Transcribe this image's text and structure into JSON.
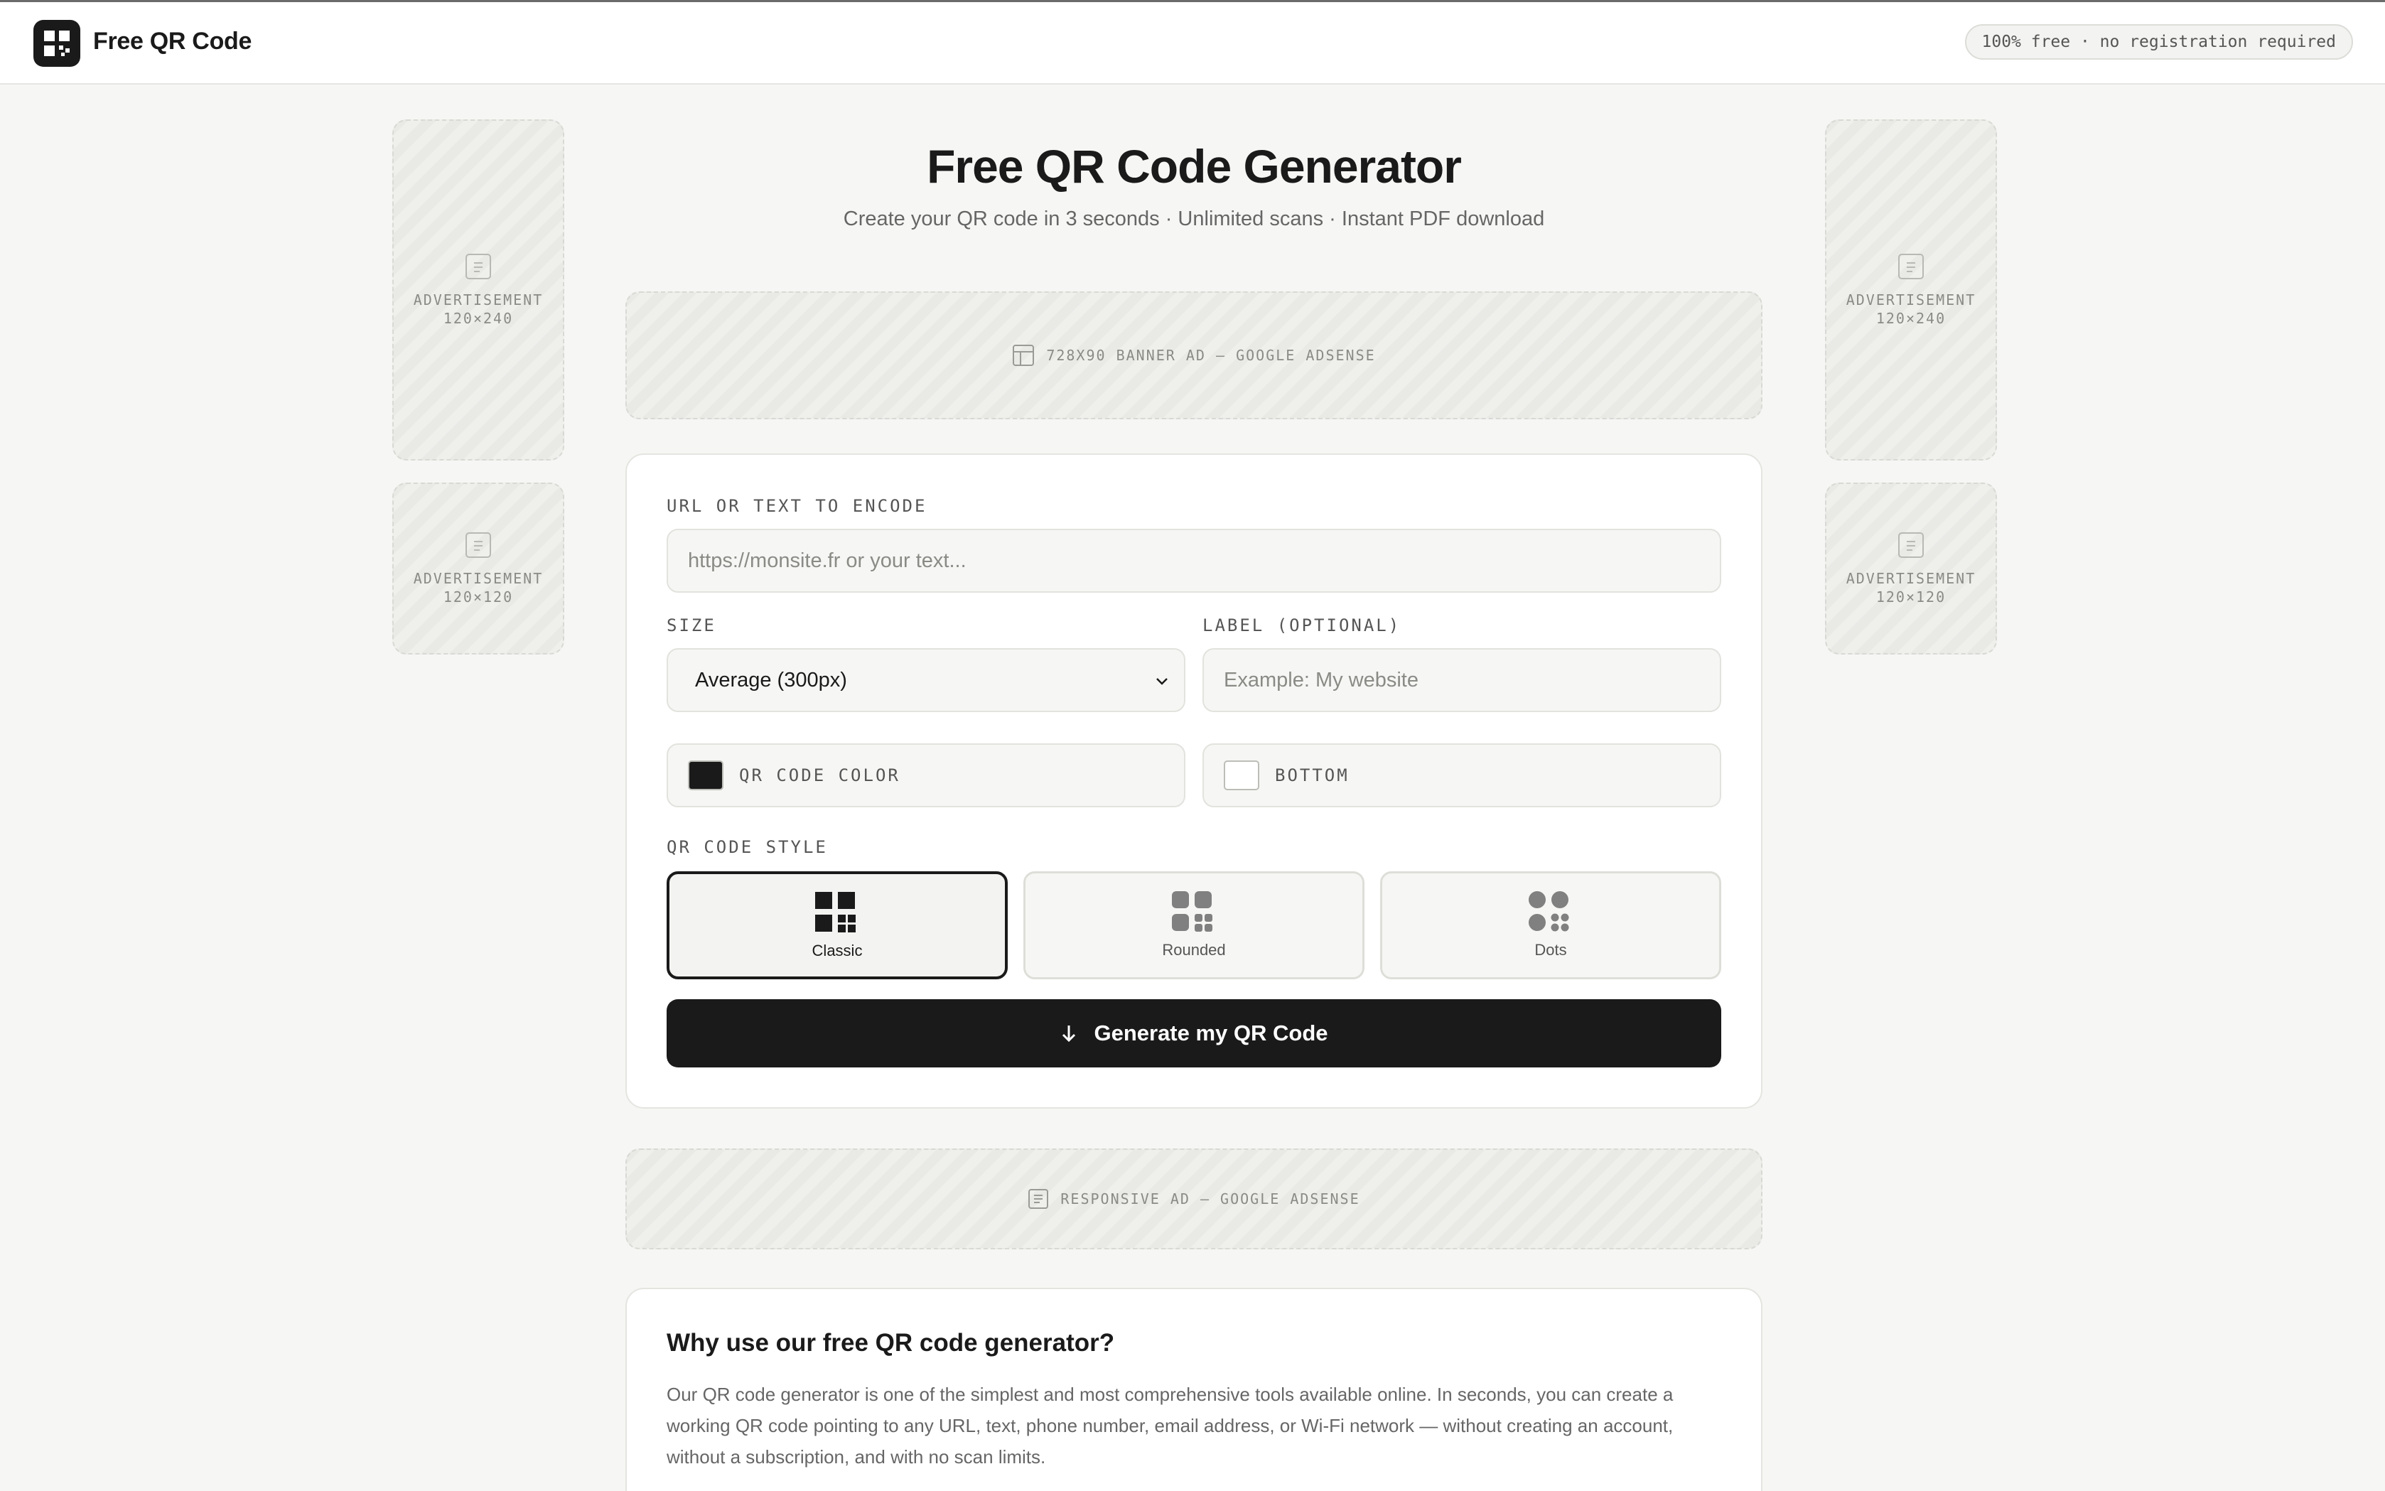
{
  "header": {
    "brand": "Free QR Code",
    "badge": "100% free · no registration required"
  },
  "hero": {
    "title": "Free QR Code Generator",
    "subtitle": "Create your QR code in 3 seconds · Unlimited scans · Instant PDF download"
  },
  "ads": {
    "left_top": {
      "line1": "ADVERTISEMENT",
      "line2": "120×240"
    },
    "left_bottom": {
      "line1": "ADVERTISEMENT",
      "line2": "120×120"
    },
    "right_top": {
      "line1": "ADVERTISEMENT",
      "line2": "120×240"
    },
    "right_bottom": {
      "line1": "ADVERTISEMENT",
      "line2": "120×120"
    },
    "banner_top": "728X90 BANNER AD — GOOGLE ADSENSE",
    "banner_mid": "RESPONSIVE AD — GOOGLE ADSENSE"
  },
  "form": {
    "url_label": "URL OR TEXT TO ENCODE",
    "url_placeholder": "https://monsite.fr or your text...",
    "size_label": "SIZE",
    "size_value": "Average (300px)",
    "label_label": "LABEL (OPTIONAL)",
    "label_placeholder": "Example: My website",
    "qr_color_label": "QR CODE COLOR",
    "qr_color": "#1a1a1a",
    "bottom_color_label": "BOTTOM",
    "bottom_color": "#ffffff",
    "style_label": "QR CODE STYLE",
    "styles": [
      {
        "label": "Classic",
        "selected": true
      },
      {
        "label": "Rounded",
        "selected": false
      },
      {
        "label": "Dots",
        "selected": false
      }
    ],
    "generate_label": "Generate my QR Code"
  },
  "why": {
    "title": "Why use our free QR code generator?",
    "text": "Our QR code generator is one of the simplest and most comprehensive tools available online. In seconds, you can create a working QR code pointing to any URL, text, phone number, email address, or Wi-Fi network — without creating an account, without a subscription, and with no scan limits."
  },
  "colors": {
    "accent": "#1a1a1a",
    "background": "#f6f6f4",
    "card": "#ffffff"
  }
}
